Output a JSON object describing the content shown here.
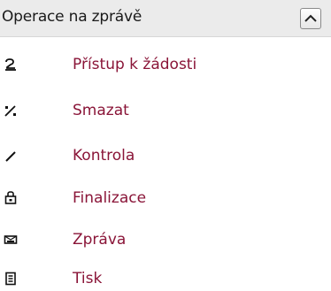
{
  "panel": {
    "title": "Operace na zprávě",
    "collapse_icon": "chevron-up-icon"
  },
  "items": [
    {
      "label": "Přístup k žádosti",
      "icon": "user-access-icon"
    },
    {
      "label": "Smazat",
      "icon": "delete-icon"
    },
    {
      "label": "Kontrola",
      "icon": "check-icon"
    },
    {
      "label": "Finalizace",
      "icon": "lock-icon"
    },
    {
      "label": "Zpráva",
      "icon": "message-icon"
    },
    {
      "label": "Tisk",
      "icon": "print-icon"
    }
  ],
  "colors": {
    "link": "#8a1538",
    "header_bg": "#ebebeb"
  }
}
